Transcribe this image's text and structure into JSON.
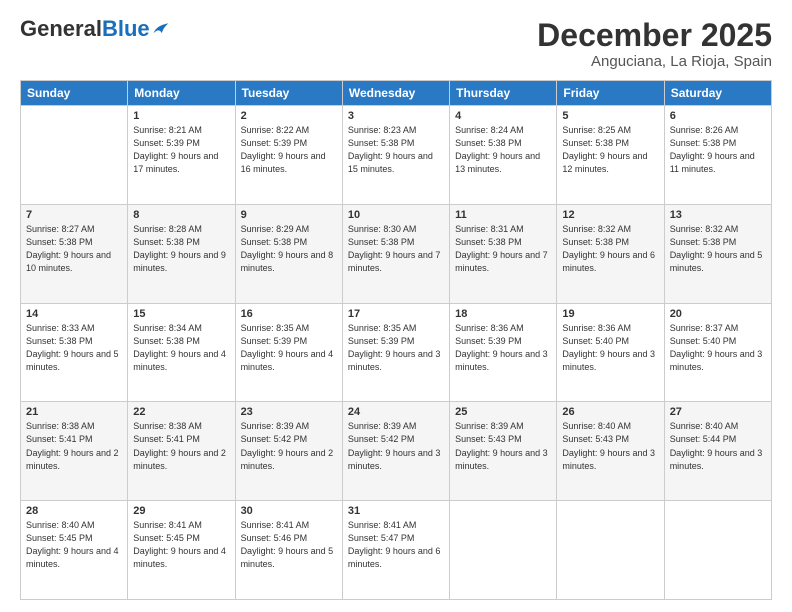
{
  "logo": {
    "general": "General",
    "blue": "Blue"
  },
  "header": {
    "month": "December 2025",
    "location": "Anguciana, La Rioja, Spain"
  },
  "weekdays": [
    "Sunday",
    "Monday",
    "Tuesday",
    "Wednesday",
    "Thursday",
    "Friday",
    "Saturday"
  ],
  "weeks": [
    [
      {
        "day": "",
        "info": ""
      },
      {
        "day": "1",
        "info": "Sunrise: 8:21 AM\nSunset: 5:39 PM\nDaylight: 9 hours and 17 minutes."
      },
      {
        "day": "2",
        "info": "Sunrise: 8:22 AM\nSunset: 5:39 PM\nDaylight: 9 hours and 16 minutes."
      },
      {
        "day": "3",
        "info": "Sunrise: 8:23 AM\nSunset: 5:38 PM\nDaylight: 9 hours and 15 minutes."
      },
      {
        "day": "4",
        "info": "Sunrise: 8:24 AM\nSunset: 5:38 PM\nDaylight: 9 hours and 13 minutes."
      },
      {
        "day": "5",
        "info": "Sunrise: 8:25 AM\nSunset: 5:38 PM\nDaylight: 9 hours and 12 minutes."
      },
      {
        "day": "6",
        "info": "Sunrise: 8:26 AM\nSunset: 5:38 PM\nDaylight: 9 hours and 11 minutes."
      }
    ],
    [
      {
        "day": "7",
        "info": "Sunrise: 8:27 AM\nSunset: 5:38 PM\nDaylight: 9 hours and 10 minutes."
      },
      {
        "day": "8",
        "info": "Sunrise: 8:28 AM\nSunset: 5:38 PM\nDaylight: 9 hours and 9 minutes."
      },
      {
        "day": "9",
        "info": "Sunrise: 8:29 AM\nSunset: 5:38 PM\nDaylight: 9 hours and 8 minutes."
      },
      {
        "day": "10",
        "info": "Sunrise: 8:30 AM\nSunset: 5:38 PM\nDaylight: 9 hours and 7 minutes."
      },
      {
        "day": "11",
        "info": "Sunrise: 8:31 AM\nSunset: 5:38 PM\nDaylight: 9 hours and 7 minutes."
      },
      {
        "day": "12",
        "info": "Sunrise: 8:32 AM\nSunset: 5:38 PM\nDaylight: 9 hours and 6 minutes."
      },
      {
        "day": "13",
        "info": "Sunrise: 8:32 AM\nSunset: 5:38 PM\nDaylight: 9 hours and 5 minutes."
      }
    ],
    [
      {
        "day": "14",
        "info": "Sunrise: 8:33 AM\nSunset: 5:38 PM\nDaylight: 9 hours and 5 minutes."
      },
      {
        "day": "15",
        "info": "Sunrise: 8:34 AM\nSunset: 5:38 PM\nDaylight: 9 hours and 4 minutes."
      },
      {
        "day": "16",
        "info": "Sunrise: 8:35 AM\nSunset: 5:39 PM\nDaylight: 9 hours and 4 minutes."
      },
      {
        "day": "17",
        "info": "Sunrise: 8:35 AM\nSunset: 5:39 PM\nDaylight: 9 hours and 3 minutes."
      },
      {
        "day": "18",
        "info": "Sunrise: 8:36 AM\nSunset: 5:39 PM\nDaylight: 9 hours and 3 minutes."
      },
      {
        "day": "19",
        "info": "Sunrise: 8:36 AM\nSunset: 5:40 PM\nDaylight: 9 hours and 3 minutes."
      },
      {
        "day": "20",
        "info": "Sunrise: 8:37 AM\nSunset: 5:40 PM\nDaylight: 9 hours and 3 minutes."
      }
    ],
    [
      {
        "day": "21",
        "info": "Sunrise: 8:38 AM\nSunset: 5:41 PM\nDaylight: 9 hours and 2 minutes."
      },
      {
        "day": "22",
        "info": "Sunrise: 8:38 AM\nSunset: 5:41 PM\nDaylight: 9 hours and 2 minutes."
      },
      {
        "day": "23",
        "info": "Sunrise: 8:39 AM\nSunset: 5:42 PM\nDaylight: 9 hours and 2 minutes."
      },
      {
        "day": "24",
        "info": "Sunrise: 8:39 AM\nSunset: 5:42 PM\nDaylight: 9 hours and 3 minutes."
      },
      {
        "day": "25",
        "info": "Sunrise: 8:39 AM\nSunset: 5:43 PM\nDaylight: 9 hours and 3 minutes."
      },
      {
        "day": "26",
        "info": "Sunrise: 8:40 AM\nSunset: 5:43 PM\nDaylight: 9 hours and 3 minutes."
      },
      {
        "day": "27",
        "info": "Sunrise: 8:40 AM\nSunset: 5:44 PM\nDaylight: 9 hours and 3 minutes."
      }
    ],
    [
      {
        "day": "28",
        "info": "Sunrise: 8:40 AM\nSunset: 5:45 PM\nDaylight: 9 hours and 4 minutes."
      },
      {
        "day": "29",
        "info": "Sunrise: 8:41 AM\nSunset: 5:45 PM\nDaylight: 9 hours and 4 minutes."
      },
      {
        "day": "30",
        "info": "Sunrise: 8:41 AM\nSunset: 5:46 PM\nDaylight: 9 hours and 5 minutes."
      },
      {
        "day": "31",
        "info": "Sunrise: 8:41 AM\nSunset: 5:47 PM\nDaylight: 9 hours and 6 minutes."
      },
      {
        "day": "",
        "info": ""
      },
      {
        "day": "",
        "info": ""
      },
      {
        "day": "",
        "info": ""
      }
    ]
  ]
}
